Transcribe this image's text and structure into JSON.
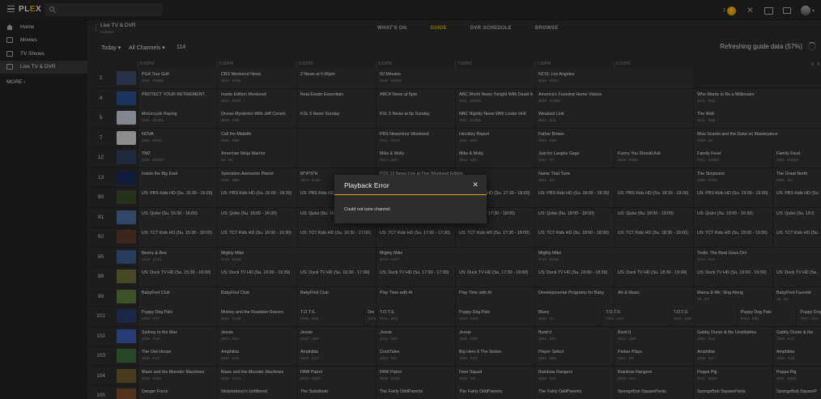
{
  "app": {
    "logo_text": "PLEX",
    "logo_accent": "#e5a00d"
  },
  "topbar": {
    "activity_count": "1"
  },
  "sidebar": {
    "items": [
      {
        "label": "Home",
        "icon": "home-icon"
      },
      {
        "label": "Movies",
        "icon": "film-icon"
      },
      {
        "label": "TV Shows",
        "icon": "tv-icon"
      },
      {
        "label": "Live TV & DVR",
        "icon": "live-tv-icon",
        "active": true
      }
    ],
    "more": "MORE"
  },
  "source": {
    "name": "Live TV & DVR",
    "sub": "Gotham"
  },
  "tabs": [
    {
      "label": "WHAT'S ON"
    },
    {
      "label": "GUIDE",
      "active": true
    },
    {
      "label": "DVR SCHEDULE"
    },
    {
      "label": "BROWSE"
    }
  ],
  "toolbar": {
    "day": "Today",
    "channels": "All Channels",
    "count": "114",
    "refresh": "Refreshing guide data (57%)"
  },
  "timeline": [
    "5:00PM",
    "5:30PM",
    "6:00PM",
    "6:30PM",
    "7:00PM",
    "7:30PM",
    "8:00PM"
  ],
  "rows": [
    {
      "ch": "2",
      "logo": "#3a4a6a",
      "progs": [
        {
          "t": "PGA Tour Golf",
          "m": "2021 · E0865",
          "b": "NEW",
          "w": 1
        },
        {
          "t": "CBS Weekend News",
          "m": "2021 · E489",
          "b": "NEW",
          "w": 1
        },
        {
          "t": "2 News at 5:00pm",
          "m": "",
          "b": "NEW",
          "w": 1
        },
        {
          "t": "60 Minutes",
          "m": "2021 · E1535",
          "b": "NEW",
          "w": 2
        },
        {
          "t": "NCIS: Los Angeles",
          "m": "2020 · E270",
          "b": "",
          "w": 2
        }
      ]
    },
    {
      "ch": "4",
      "logo": "#2a4d8a",
      "progs": [
        {
          "t": "PROTECT YOUR RETIREMENT",
          "m": "",
          "b": "",
          "w": 1
        },
        {
          "t": "Inside Edition Weekend",
          "m": "2021 · E644",
          "b": "NEW",
          "w": 1
        },
        {
          "t": "Real Estate Essentials",
          "m": "",
          "b": "",
          "w": 1
        },
        {
          "t": "ABC4 News at 5pm",
          "m": "",
          "b": "NEW",
          "w": 1
        },
        {
          "t": "ABC World News Tonight With David Muir",
          "m": "2021 · E2004",
          "b": "NEW",
          "w": 1
        },
        {
          "t": "America's Funniest Home Videos",
          "m": "2020 · E1402",
          "b": "",
          "w": 2
        },
        {
          "t": "Who Wants to Be a Millionaire",
          "m": "2021 · E22",
          "b": "NEW",
          "w": 2
        }
      ]
    },
    {
      "ch": "5",
      "logo": "#c0c8d0",
      "progs": [
        {
          "t": "Motorcycle Racing",
          "m": "2021 · E8461",
          "b": "",
          "w": 1
        },
        {
          "t": "Ocean Mysteries With Jeff Corwin",
          "m": "2016 · E08",
          "b": "",
          "w": 1
        },
        {
          "t": "KSL 5 News Sunday",
          "m": "",
          "b": "NEW",
          "w": 1
        },
        {
          "t": "KSL 5 News at 5p Sunday",
          "m": "",
          "b": "NEW",
          "w": 1
        },
        {
          "t": "NBC Nightly News With Lester Holt",
          "m": "2021 · E1888",
          "b": "NEW",
          "w": 1
        },
        {
          "t": "Weakest Link",
          "m": "2021 · E11",
          "b": "",
          "w": 2
        },
        {
          "t": "The Wall",
          "m": "2021 · E58",
          "b": "",
          "w": 2
        }
      ]
    },
    {
      "ch": "7",
      "logo": "#d0d0d0",
      "progs": [
        {
          "t": "NOVA",
          "m": "2021 · E531",
          "b": "",
          "w": 1
        },
        {
          "t": "Call the Midwife",
          "m": "2020 · E86",
          "b": "",
          "w": 1
        },
        {
          "t": "",
          "m": "",
          "b": "",
          "w": 1
        },
        {
          "t": "PBS NewsHour Weekend",
          "m": "2021 · E174",
          "b": "NEW",
          "w": 1
        },
        {
          "t": "Hinckley Report",
          "m": "2021 · E63",
          "b": "",
          "w": 1
        },
        {
          "t": "Father Brown",
          "m": "2020 · E89",
          "b": "",
          "w": 2
        },
        {
          "t": "Miss Scarlet and the Duke on Masterpiece",
          "m": "2020 · E5",
          "b": "NEW",
          "w": 2
        }
      ]
    },
    {
      "ch": "12",
      "logo": "#2e3f5c",
      "progs": [
        {
          "t": "TMZ",
          "m": "2021 · E4200",
          "b": "NEW",
          "w": 1
        },
        {
          "t": "American Ninja Warrior",
          "m": "S1 · E1",
          "b": "",
          "w": 1
        },
        {
          "t": "",
          "m": "",
          "b": "",
          "w": 1
        },
        {
          "t": "Mike & Molly",
          "m": "2014 · E92",
          "b": "",
          "w": 1
        },
        {
          "t": "Mike & Molly",
          "m": "2014 · E84",
          "b": "",
          "w": 1
        },
        {
          "t": "Just for Laughs Gags",
          "m": "2017 · E7",
          "b": "",
          "w": 1
        },
        {
          "t": "Funny You Should Ask",
          "m": "2018 · E305",
          "b": "",
          "w": 1
        },
        {
          "t": "Family Feud",
          "m": "2021 · E1663",
          "b": "",
          "w": 1
        },
        {
          "t": "Family Feud",
          "m": "2021 · E1664",
          "b": "",
          "w": 1
        }
      ]
    },
    {
      "ch": "13",
      "logo": "#1a2a5a",
      "progs": [
        {
          "t": "Inside the Big East",
          "m": "",
          "b": "NEW",
          "w": 1
        },
        {
          "t": "Xploration Awesome Planet",
          "m": "2020 · E85",
          "b": "",
          "w": 1
        },
        {
          "t": "M*A*S*H",
          "m": "1973 · E120",
          "b": "",
          "w": 1
        },
        {
          "t": "FOX 13 News Live at Five Weekend Edition",
          "m": "",
          "b": "NEW",
          "w": 2
        },
        {
          "t": "Name That Tune",
          "m": "2021 · E2",
          "b": "",
          "w": 2
        },
        {
          "t": "The Simpsons",
          "m": "2020 · E700",
          "b": "",
          "w": 1
        },
        {
          "t": "The Great North",
          "m": "2021 · E3",
          "b": "",
          "w": 1
        }
      ]
    },
    {
      "ch": "90",
      "logo": "#3a4a2a",
      "progs": [
        {
          "t": "US: PBS Kids HD (Su. 15:30 - 16:00)",
          "m": "",
          "b": "NEW",
          "w": 1
        },
        {
          "t": "US: PBS Kids HD (Su. 16:00 - 16:30)",
          "m": "",
          "b": "NEW",
          "w": 1
        },
        {
          "t": "US: PBS Kids HD (Su. 16:30 - 17:00)",
          "m": "",
          "b": "NEW",
          "w": 1
        },
        {
          "t": "",
          "m": "",
          "b": "",
          "w": 1
        },
        {
          "t": "US: PBS Kids HD (Su. 17:30 - 18:00)",
          "m": "",
          "b": "NEW",
          "w": 1
        },
        {
          "t": "US: PBS Kids HD (Su. 18:00 - 18:30)",
          "m": "",
          "b": "NEW",
          "w": 1
        },
        {
          "t": "US: PBS Kids HD (Su. 18:30 - 19:00)",
          "m": "",
          "b": "NEW",
          "w": 1
        },
        {
          "t": "US: PBS Kids HD (Su. 19:00 - 19:30)",
          "m": "",
          "b": "NEW",
          "w": 1
        },
        {
          "t": "US: PBS Kids HD (Su.",
          "m": "",
          "b": "NEW",
          "w": 1
        }
      ]
    },
    {
      "ch": "91",
      "logo": "#4a6a9a",
      "progs": [
        {
          "t": "US: Qubo (Su. 15:30 - 16:00)",
          "m": "",
          "b": "NEW",
          "w": 1
        },
        {
          "t": "US: Qubo (Su. 16:00 - 16:30)",
          "m": "",
          "b": "NEW",
          "w": 1
        },
        {
          "t": "US: Qubo (Su. 16:30 - 17:00)",
          "m": "",
          "b": "NEW",
          "w": 1
        },
        {
          "t": "",
          "m": "",
          "b": "",
          "w": 1
        },
        {
          "t": "US: Qubo (Su. 17:30 - 18:00)",
          "m": "",
          "b": "NEW",
          "w": 1
        },
        {
          "t": "US: Qubo (Su. 18:00 - 18:30)",
          "m": "",
          "b": "NEW",
          "w": 1
        },
        {
          "t": "US: Qubo (Su. 18:30 - 19:00)",
          "m": "",
          "b": "NEW",
          "w": 1
        },
        {
          "t": "US: Qubo (Su. 19:00 - 19:30)",
          "m": "",
          "b": "NEW",
          "w": 1
        },
        {
          "t": "US: Qubo (Su. 19:3",
          "m": "",
          "b": "NEW",
          "w": 1
        }
      ]
    },
    {
      "ch": "92",
      "logo": "#5a3a2a",
      "progs": [
        {
          "t": "US: TCT Kids HD (Su. 15:30 - 16:00)",
          "m": "",
          "b": "NEW",
          "w": 1
        },
        {
          "t": "US: TCT Kids HD (Su. 16:00 - 16:30)",
          "m": "",
          "b": "NEW",
          "w": 1
        },
        {
          "t": "US: TCT Kids HD (Su. 16:30 - 17:00)",
          "m": "",
          "b": "NEW",
          "w": 1
        },
        {
          "t": "US: TCT Kids HD (Su. 17:00 - 17:30)",
          "m": "",
          "b": "NEW",
          "w": 1
        },
        {
          "t": "US: TCT Kids HD (Su. 17:30 - 18:00)",
          "m": "",
          "b": "NEW",
          "w": 1
        },
        {
          "t": "US: TCT Kids HD (Su. 18:00 - 18:30)",
          "m": "",
          "b": "NEW",
          "w": 1
        },
        {
          "t": "US: TCT Kids HD (Su. 18:30 - 19:00)",
          "m": "",
          "b": "NEW",
          "w": 1
        },
        {
          "t": "US: TCT Kids HD (Su. 19:00 - 19:30)",
          "m": "",
          "b": "NEW",
          "w": 1
        },
        {
          "t": "US: TCT Kids HD (Su.",
          "m": "",
          "b": "NEW",
          "w": 1
        }
      ]
    },
    {
      "ch": "95",
      "logo": "#3a5a8a",
      "progs": [
        {
          "t": "Benny & Boo",
          "m": "2019 · E131",
          "b": "",
          "w": 1
        },
        {
          "t": "Mighty Mike",
          "m": "2019 · E206",
          "b": "",
          "w": 2
        },
        {
          "t": "Mighty Mike",
          "m": "2019 · E207",
          "b": "",
          "w": 2
        },
        {
          "t": "Mighty Mike",
          "m": "2019 · E208",
          "b": "",
          "w": 2
        },
        {
          "t": "Trolls: The Beat Goes On!",
          "m": "2019 · E40",
          "b": "",
          "w": 2
        }
      ]
    },
    {
      "ch": "98",
      "logo": "#6a6a3a",
      "progs": [
        {
          "t": "US: Duck TV HD (Su. 15:30 - 16:00)",
          "m": "",
          "b": "NEW",
          "w": 1
        },
        {
          "t": "US: Duck TV HD (Su. 16:00 - 16:30)",
          "m": "",
          "b": "NEW",
          "w": 1
        },
        {
          "t": "US: Duck TV HD (Su. 16:30 - 17:00)",
          "m": "",
          "b": "NEW",
          "w": 1
        },
        {
          "t": "US: Duck TV HD (Su. 17:00 - 17:30)",
          "m": "",
          "b": "NEW",
          "w": 1
        },
        {
          "t": "US: Duck TV HD (Su. 17:30 - 18:00)",
          "m": "",
          "b": "NEW",
          "w": 1
        },
        {
          "t": "US: Duck TV HD (Su. 18:00 - 18:30)",
          "m": "",
          "b": "NEW",
          "w": 1
        },
        {
          "t": "US: Duck TV HD (Su. 18:30 - 19:00)",
          "m": "",
          "b": "NEW",
          "w": 1
        },
        {
          "t": "US: Duck TV HD (Su. 19:00 - 19:30)",
          "m": "",
          "b": "NEW",
          "w": 1
        },
        {
          "t": "US: Duck TV HD (Su.",
          "m": "",
          "b": "NEW",
          "w": 1
        }
      ]
    },
    {
      "ch": "99",
      "logo": "#5a7a3a",
      "progs": [
        {
          "t": "BabyFirst Club",
          "m": "",
          "b": "",
          "w": 1
        },
        {
          "t": "BabyFirst Club",
          "m": "",
          "b": "",
          "w": 1
        },
        {
          "t": "BabyFirst Club",
          "m": "",
          "b": "",
          "w": 1
        },
        {
          "t": "Play Time with Al",
          "m": "",
          "b": "",
          "w": 1
        },
        {
          "t": "Play Time with Al",
          "m": "",
          "b": "",
          "w": 1
        },
        {
          "t": "Developmental Programs for Baby",
          "m": "",
          "b": "",
          "w": 1
        },
        {
          "t": "Art & Music",
          "m": "",
          "b": "",
          "w": 1
        },
        {
          "t": "Mama & Me: Sing Along",
          "m": "S6 · E1",
          "b": "",
          "w": 1
        },
        {
          "t": "BabyFirst Favorite",
          "m": "S6 · E1",
          "b": "",
          "w": 1
        }
      ]
    },
    {
      "ch": "101",
      "logo": "#2a3a6a",
      "progs": [
        {
          "t": "Puppy Dog Pals",
          "m": "2018 · E77",
          "b": "",
          "w": 1
        },
        {
          "t": "Mickey and the Roadster Racers",
          "m": "2018 · E149",
          "b": "",
          "w": 1
        },
        {
          "t": "T.O.T.S.",
          "m": "2020 · E29",
          "b": "",
          "w": 0.85
        },
        {
          "t": "Doc M",
          "m": "2018",
          "b": "",
          "w": 0.15
        },
        {
          "t": "T.O.T.S.",
          "m": "2021 · E44",
          "b": "",
          "w": 1
        },
        {
          "t": "Puppy Dog Pals",
          "m": "2020 · E231",
          "b": "",
          "w": 1
        },
        {
          "t": "Bluey",
          "m": "2019 · E1",
          "b": "",
          "w": 0.85
        },
        {
          "t": "T.O.T.S.",
          "m": "2021 · E53",
          "b": "",
          "w": 0.85
        },
        {
          "t": "T.O.T.S.",
          "m": "2019 · E26",
          "b": "",
          "w": 0.85
        },
        {
          "t": "Puppy Dog Pals",
          "m": "2019 · E86",
          "b": "",
          "w": 0.75
        },
        {
          "t": "Puppy Dog P",
          "m": "2017 · E12",
          "b": "",
          "w": 0.8
        }
      ]
    },
    {
      "ch": "102",
      "logo": "#3a5aaa",
      "progs": [
        {
          "t": "Sydney to the Max",
          "m": "2019 · E28",
          "b": "",
          "w": 1
        },
        {
          "t": "Jessie",
          "m": "2014 · E94",
          "b": "",
          "w": 1
        },
        {
          "t": "Jessie",
          "m": "2015 · E98",
          "b": "",
          "w": 1
        },
        {
          "t": "Jessie",
          "m": "2015 · E97",
          "b": "",
          "w": 1
        },
        {
          "t": "Jessie",
          "m": "2015 · E98",
          "b": "",
          "w": 1
        },
        {
          "t": "Bunk'd",
          "m": "2021 · E97",
          "b": "",
          "w": 1
        },
        {
          "t": "Bunk'd",
          "m": "2021 · E98",
          "b": "",
          "w": 1
        },
        {
          "t": "Gabby Duran & the Unsittables",
          "m": "2020 · E16",
          "b": "",
          "w": 1
        },
        {
          "t": "Gabby Duran & the",
          "m": "2020 · E17",
          "b": "",
          "w": 1
        }
      ]
    },
    {
      "ch": "103",
      "logo": "#3a6a3a",
      "progs": [
        {
          "t": "The Owl House",
          "m": "2020 · E13",
          "b": "",
          "w": 1
        },
        {
          "t": "Amphibia",
          "m": "2020 · E49",
          "b": "",
          "w": 1
        },
        {
          "t": "Amphibia",
          "m": "2019 · E14",
          "b": "",
          "w": 1
        },
        {
          "t": "DuckTales",
          "m": "2020 · E57",
          "b": "",
          "w": 1
        },
        {
          "t": "Big Hero 6 The Series",
          "m": "2019 · E49",
          "b": "",
          "w": 1
        },
        {
          "t": "Player Select",
          "m": "2021 · E82",
          "b": "",
          "w": 1
        },
        {
          "t": "Parker Plays",
          "m": "2021 · E9",
          "b": "",
          "w": 1
        },
        {
          "t": "Amphibia",
          "m": "2019 · E17",
          "b": "",
          "w": 1
        },
        {
          "t": "Amphibia",
          "m": "2019 · E18",
          "b": "",
          "w": 1
        }
      ]
    },
    {
      "ch": "104",
      "logo": "#6a5a2a",
      "progs": [
        {
          "t": "Blaze and the Monster Machines",
          "m": "2018 · E114",
          "b": "",
          "w": 1
        },
        {
          "t": "Blaze and the Monster Machines",
          "m": "2018 · E122",
          "b": "",
          "w": 1
        },
        {
          "t": "PAW Patrol",
          "m": "2019 · E208",
          "b": "",
          "w": 1
        },
        {
          "t": "PAW Patrol",
          "m": "2019 · E233",
          "b": "",
          "w": 1
        },
        {
          "t": "Deer Squad",
          "m": "2020 · E5",
          "b": "",
          "w": 1
        },
        {
          "t": "Rainbow Rangers",
          "m": "2019 · E41",
          "b": "",
          "w": 1
        },
        {
          "t": "Rainbow Rangers",
          "m": "2019 · E54",
          "b": "",
          "w": 1
        },
        {
          "t": "Peppa Pig",
          "m": "2011 · E242",
          "b": "",
          "w": 1
        },
        {
          "t": "Peppa Pig",
          "m": "2011 · E243",
          "b": "",
          "w": 1
        }
      ]
    },
    {
      "ch": "105",
      "logo": "#7a4a2a",
      "progs": [
        {
          "t": "Danger Force",
          "m": "",
          "b": "",
          "w": 1
        },
        {
          "t": "Nickelodeon's Unfiltered",
          "m": "",
          "b": "",
          "w": 1
        },
        {
          "t": "The Substitute",
          "m": "",
          "b": "",
          "w": 1
        },
        {
          "t": "The Fairly OddParents",
          "m": "",
          "b": "",
          "w": 1
        },
        {
          "t": "The Fairly OddParents",
          "m": "",
          "b": "",
          "w": 1
        },
        {
          "t": "The Fairly OddParents",
          "m": "",
          "b": "",
          "w": 1
        },
        {
          "t": "SpongeBob SquarePants",
          "m": "",
          "b": "",
          "w": 1
        },
        {
          "t": "SpongeBob SquarePants",
          "m": "",
          "b": "",
          "w": 1
        },
        {
          "t": "SpongeBob SquareP",
          "m": "",
          "b": "",
          "w": 1
        }
      ]
    }
  ],
  "dialog": {
    "title": "Playback Error",
    "message": "Could not tune channel",
    "accent": "#e5a00d"
  }
}
